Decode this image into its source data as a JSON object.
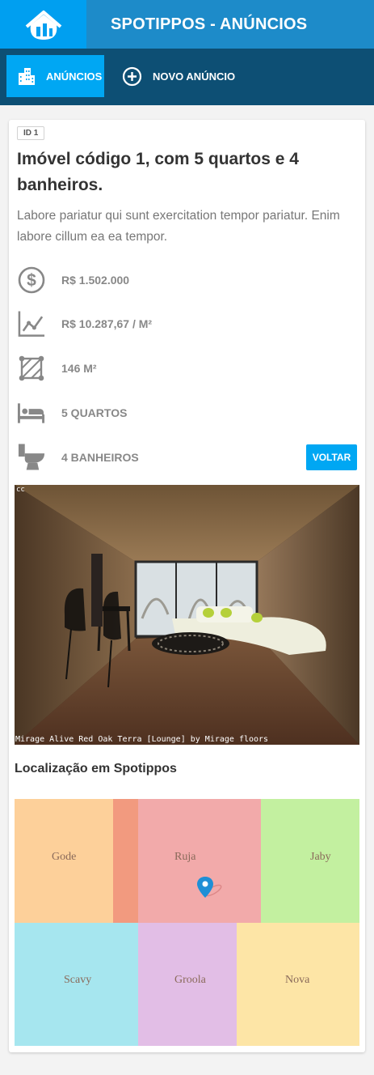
{
  "header": {
    "title": "SPOTIPPOS - ANÚNCIOS",
    "logo_icon": "house-logo-icon"
  },
  "nav": {
    "items": [
      {
        "label": "ANÚNCIOS",
        "icon": "buildings-icon",
        "active": true
      },
      {
        "label": "NOVO ANÚNCIO",
        "icon": "plus-circle-icon",
        "active": false
      }
    ]
  },
  "listing": {
    "id_badge": "ID 1",
    "title": "Imóvel código 1, com 5 quartos e 4 banheiros.",
    "description": "Labore pariatur qui sunt exercitation tempor pariatur. Enim labore cillum ea ea tempor.",
    "features": {
      "price": "R$ 1.502.000",
      "price_per_m2": "R$ 10.287,67 / M²",
      "area": "146 M²",
      "beds": "5 QUARTOS",
      "baths": "4 BANHEIROS"
    },
    "back_label": "VOLTAR",
    "photo": {
      "cc_label": "cc",
      "credit": "Mirage Alive Red Oak Terra [Lounge] by Mirage floors"
    }
  },
  "location": {
    "title": "Localização em Spotippos",
    "provinces": {
      "gode": "Gode",
      "ruja": "Ruja",
      "jaby": "Jaby",
      "scavy": "Scavy",
      "groola": "Groola",
      "nova": "Nova"
    },
    "pin_icon": "map-pin-icon"
  },
  "colors": {
    "header": "#1d8bc9",
    "logo_bg": "#009ff0",
    "nav": "#0d4f74",
    "accent": "#00a7f3",
    "gode": "#fdd09a",
    "overlap": "#f29a7f",
    "ruja": "#f2aaaa",
    "jaby": "#c3f0a0",
    "scavy": "#a6e6ef",
    "groola": "#e2bee6",
    "nova": "#fde5a6"
  }
}
